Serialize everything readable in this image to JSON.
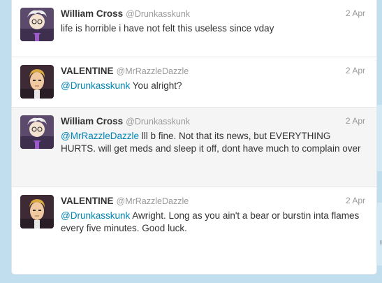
{
  "tweets": [
    {
      "name": "William Cross",
      "handle": "@Drunkasskunk",
      "time": "2 Apr",
      "mention": "",
      "text": "life is horrible i have not felt this useless since vday"
    },
    {
      "name": "VALENTINE",
      "handle": "@MrRazzleDazzle",
      "time": "2 Apr",
      "mention": "@Drunkasskunk",
      "text": " You alright?"
    },
    {
      "name": "William Cross",
      "handle": "@Drunkasskunk",
      "time": "2 Apr",
      "mention": "@MrRazzleDazzle",
      "text": " lll b fine. Not that its news, but EVERYTHING HURTS. will get meds and sleep it off, dont have much to complain over"
    },
    {
      "name": "VALENTINE",
      "handle": "@MrRazzleDazzle",
      "time": "2 Apr",
      "mention": "@Drunkasskunk",
      "text": " Awright. Long as you ain't a bear or burstin inta flames every five minutes. Good luck."
    }
  ],
  "side_mark": "!"
}
